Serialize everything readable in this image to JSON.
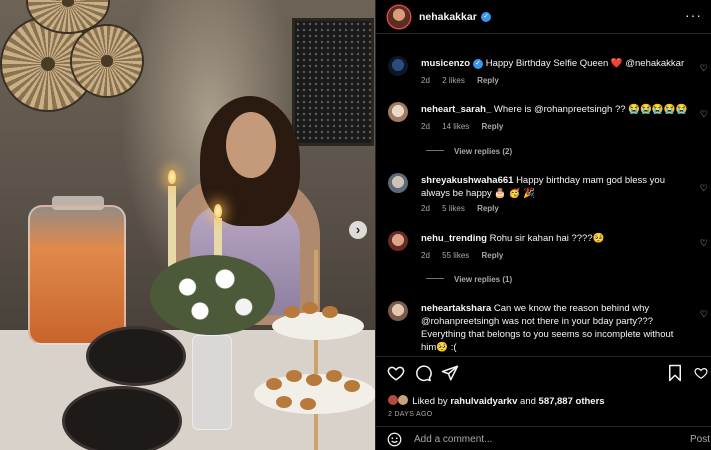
{
  "post": {
    "author": "nehakakkar",
    "more_icon": "more-horizontal-icon",
    "next_icon": "chevron-right-icon"
  },
  "comments": [
    {
      "user": "musicenzo",
      "verified": true,
      "text": "Happy Birthday Selfie Queen ❤️ @nehakakkar",
      "age": "2d",
      "likes": "2 likes",
      "reply": "Reply"
    },
    {
      "user": "neheart_sarah_",
      "verified": false,
      "text": "Where is @rohanpreetsingh ?? 😭😭😭😭😭",
      "age": "2d",
      "likes": "14 likes",
      "reply": "Reply",
      "view_replies": "View replies (2)"
    },
    {
      "user": "shreyakushwaha661",
      "verified": false,
      "text": "Happy birthday mam god bless you always be happy 🎂 🥳 🎉",
      "age": "2d",
      "likes": "5 likes",
      "reply": "Reply"
    },
    {
      "user": "nehu_trending",
      "verified": false,
      "text": "Rohu sir kahan hai ????🥺",
      "age": "2d",
      "likes": "55 likes",
      "reply": "Reply",
      "view_replies": "View replies (1)"
    },
    {
      "user": "neheartakshara",
      "verified": false,
      "text": "Can we know the reason behind why @rohanpreetsingh was not there in your bday party??? Everything that belongs to you seems so incomplete without him🥺 :(",
      "age": "",
      "likes": "",
      "reply": ""
    }
  ],
  "likes_bar": {
    "prefix": "Liked by",
    "liked_user": "rahulvaidyarkv",
    "connector": "and",
    "others": "587,887 others"
  },
  "timestamp": "2 DAYS AGO",
  "add_comment": {
    "placeholder": "Add a comment...",
    "post_label": "Post"
  },
  "colors": {
    "verified": "#3797f0",
    "secondary_text": "#a8a8a8",
    "background": "#000000"
  }
}
